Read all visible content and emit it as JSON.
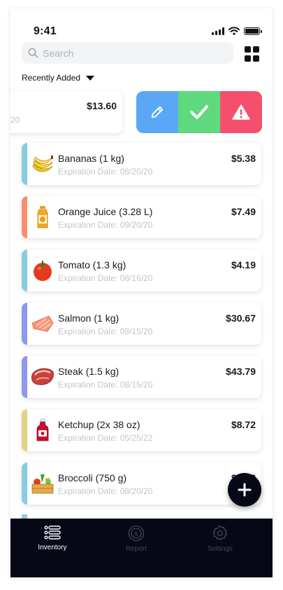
{
  "status_bar": {
    "time": "9:41"
  },
  "search": {
    "placeholder": "Search",
    "value": ""
  },
  "sort": {
    "label": "Recently Added"
  },
  "swiped_item": {
    "price": "$13.60",
    "expiration_fragment": "20"
  },
  "swipe_actions": [
    {
      "name": "edit",
      "icon": "pencil-icon",
      "color": "#5aa8f5"
    },
    {
      "name": "mark-used",
      "icon": "check-icon",
      "color": "#5fd97e"
    },
    {
      "name": "report",
      "icon": "warning-icon",
      "color": "#f4506e"
    }
  ],
  "items": [
    {
      "name": "Bananas (1 kg)",
      "expiration": "Expiration Date: 08/20/20",
      "price": "$5.38",
      "accent": "#87cce3",
      "icon": "banana-icon"
    },
    {
      "name": "Orange Juice (3.28 L)",
      "expiration": "Expiration Date: 09/20/20",
      "price": "$7.49",
      "accent": "#f98e6d",
      "icon": "juice-icon"
    },
    {
      "name": "Tomato (1.3 kg)",
      "expiration": "Expiration Date: 08/16/20",
      "price": "$4.19",
      "accent": "#87cce3",
      "icon": "tomato-icon"
    },
    {
      "name": "Salmon (1 kg)",
      "expiration": "Expiration Date: 08/15/20",
      "price": "$30.67",
      "accent": "#8e96ee",
      "icon": "salmon-icon"
    },
    {
      "name": "Steak (1.5 kg)",
      "expiration": "Expiration Date: 08/15/20",
      "price": "$43.79",
      "accent": "#8e96ee",
      "icon": "steak-icon"
    },
    {
      "name": "Ketchup (2x 38 oz)",
      "expiration": "Expiration Date: 05/25/22",
      "price": "$8.72",
      "accent": "#e5d185",
      "icon": "ketchup-icon"
    },
    {
      "name": "Broccoli (750 g)",
      "expiration": "Expiration Date: 08/20/20",
      "price": "$7.58",
      "accent": "#87cce3",
      "icon": "vegetable-crate-icon"
    }
  ],
  "tabs": [
    {
      "label": "Inventory",
      "icon": "list-icon",
      "active": true
    },
    {
      "label": "Report",
      "icon": "coin-icon",
      "active": false
    },
    {
      "label": "Settings",
      "icon": "gear-icon",
      "active": false
    }
  ],
  "colors": {
    "tabbar": "#070816",
    "fab": "#070816"
  }
}
